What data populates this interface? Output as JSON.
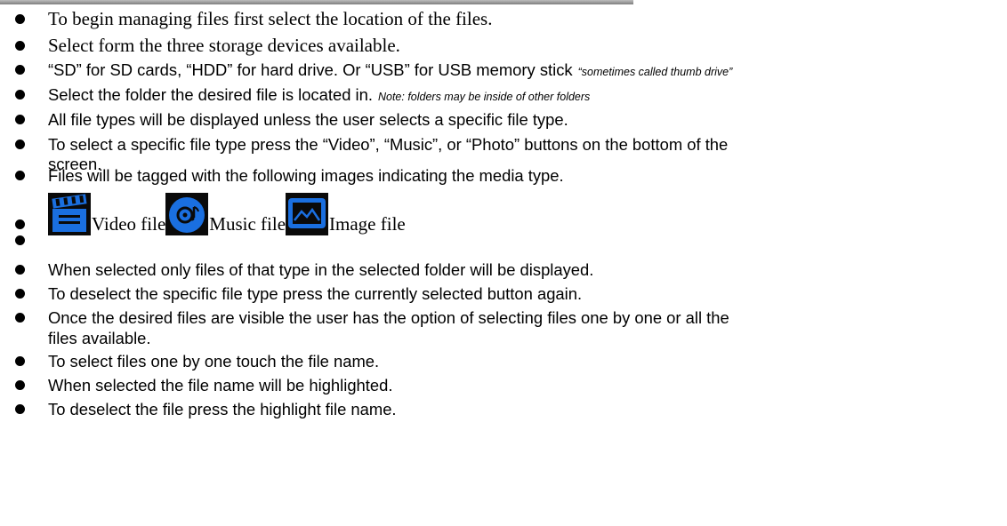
{
  "colors": {
    "bullet": "#000000",
    "icon_bg": "#0a0a0a",
    "icon_blue": "#1a6fe0"
  },
  "items": [
    {
      "text": "To begin managing files first select the location of the files."
    },
    {
      "text": "Select form the three storage devices available."
    },
    {
      "text": "“SD” for SD cards, “HDD” for hard drive. Or “USB” for USB memory stick",
      "note": "“sometimes called thumb drive”"
    },
    {
      "text": "Select the folder the desired file is located in.",
      "note": "Note: folders may be inside of other folders"
    },
    {
      "text": "All file types will be displayed unless the user selects a specific file type."
    },
    {
      "text": "To select a specific file type press the “Video”, “Music”, or “Photo” buttons on the bottom of the",
      "cont": "screen."
    },
    {
      "text": "Files will be tagged with the following images indicating the media type."
    },
    {
      "text": "When selected only files of that type in the selected folder will be displayed."
    },
    {
      "text": "To deselect the specific file type press the currently selected button again."
    },
    {
      "text": "Once the desired files are visible the user has the option of selecting files one by one or all the",
      "cont": "files available."
    },
    {
      "text": "To select files one by one touch the file name."
    },
    {
      "text": "When selected the file name will be highlighted."
    },
    {
      "text": "To deselect the file press the highlight file name."
    }
  ],
  "media_icons": [
    {
      "icon": "video-clapper-icon",
      "label": "Video file"
    },
    {
      "icon": "music-disc-icon",
      "label": "Music file"
    },
    {
      "icon": "image-landscape-icon",
      "label": "Image file"
    }
  ]
}
